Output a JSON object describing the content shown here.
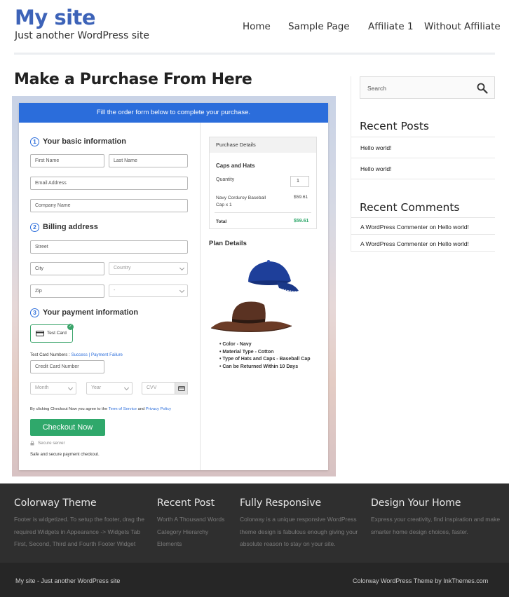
{
  "site": {
    "title": "My site",
    "tagline": "Just another WordPress site"
  },
  "nav": [
    "Home",
    "Sample Page",
    "Affiliate 1",
    "Without Affiliate"
  ],
  "page": {
    "title": "Make a Purchase From Here"
  },
  "form": {
    "banner": "Fill the order form below to complete your purchase.",
    "step1": {
      "num": "1",
      "title": "Your basic information"
    },
    "first_name": "First Name",
    "last_name": "Last Name",
    "email": "Email Address",
    "company": "Company Name",
    "step2": {
      "num": "2",
      "title": "Billing address"
    },
    "street": "Street",
    "city": "City",
    "country": "Country",
    "zip": "Zip",
    "state": "-",
    "step3": {
      "num": "3",
      "title": "Your payment information"
    },
    "test_card": "Test Card",
    "card_numbers_label": "Test Card Numbers :",
    "success_link": "Success",
    "separator": "|",
    "failure_link": "Payment Failure",
    "card_number": "Credit Card Number",
    "month": "Month",
    "year": "Year",
    "cvv": "CVV",
    "terms_prefix": "By clicking Checkout Now you agree to the",
    "terms_link": "Term of Service",
    "terms_and": "and",
    "privacy_link": "Privacy Policy",
    "checkout_button": "Checkout Now",
    "secure_server": "Secure server",
    "safe_text": "Safe and secure payment checkout."
  },
  "purchase": {
    "header": "Purchase Details",
    "product": "Caps and Hats",
    "quantity_label": "Quantity",
    "quantity_value": "1",
    "item_name": "Navy Corduroy Baseball Cap x 1",
    "item_price": "$59.61",
    "total_label": "Total",
    "total_value": "$59.61",
    "total_color": "#2fa86b"
  },
  "plan": {
    "title": "Plan Details",
    "features": [
      "Color - Navy",
      "Material Type - Cotton",
      "Type of Hats and Caps - Baseball Cap",
      "Can be Returned Within 10 Days"
    ]
  },
  "sidebar": {
    "search_placeholder": "Search",
    "recent_posts_title": "Recent Posts",
    "recent_posts": [
      "Hello world!",
      "Hello world!"
    ],
    "recent_comments_title": "Recent Comments",
    "comments": [
      {
        "author": "A WordPress Commenter",
        "on": "on",
        "post": "Hello world!"
      },
      {
        "author": "A WordPress Commenter",
        "on": "on",
        "post": "Hello world!"
      }
    ]
  },
  "footer": {
    "col1": {
      "title": "Colorway Theme",
      "lines": [
        "Footer is widgetized. To setup the footer, drag the",
        "required Widgets in Appearance -> Widgets Tab",
        "First, Second, Third and Fourth Footer Widget"
      ]
    },
    "col2": {
      "title": "Recent Post",
      "lines": [
        "Worth A Thousand Words",
        "Category Hierarchy",
        "Elements"
      ]
    },
    "col3": {
      "title": "Fully Responsive",
      "lines": [
        "Colorway is a unique responsive WordPress",
        "theme design is fabulous enough giving your",
        "absolute reason to stay on your site."
      ]
    },
    "col4": {
      "title": "Design Your Home",
      "lines": [
        "Express your creativity, find inspiration and make",
        "smarter home design choices, faster."
      ]
    },
    "bottom_left": "My site - Just another WordPress site",
    "bottom_right": "Colorway WordPress Theme by InkThemes.com"
  },
  "colors": {
    "brand": "#3d63b8",
    "accent_blue": "#2b6ddb",
    "checkout_green": "#2fa86b"
  },
  "icons": [
    "search-icon",
    "credit-card-icon",
    "check-icon",
    "lock-icon",
    "chevron-down-icon",
    "card-cvv-icon"
  ]
}
